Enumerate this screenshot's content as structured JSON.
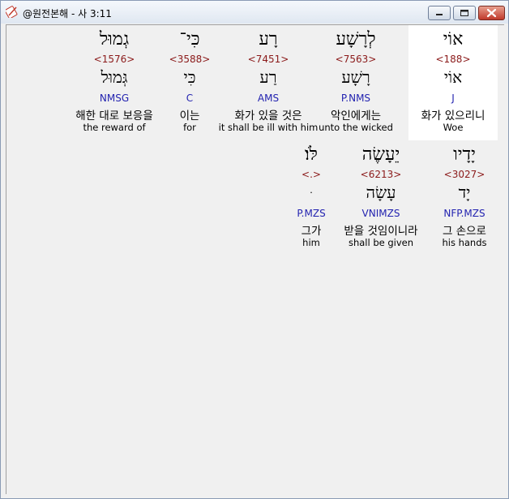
{
  "window": {
    "title": "@원전본해 - 사 3:11"
  },
  "rows": [
    [
      {
        "heb": "אוֹי",
        "strong": "<188>",
        "root": "אוֹי",
        "morph": "J",
        "kor": "화가 있으리니",
        "eng": "Woe",
        "highlighted": true
      },
      {
        "heb": "לְרָשָׁע",
        "strong": "<7563>",
        "root": "רָשָׁע",
        "morph": "P.NMS",
        "kor": "악인에게는",
        "eng": "unto the wicked",
        "highlighted": false
      },
      {
        "heb": "רָע",
        "strong": "<7451>",
        "root": "רַע",
        "morph": "AMS",
        "kor": "화가 있을 것은",
        "eng": "it shall be ill with him",
        "highlighted": false
      },
      {
        "heb": "כִּי־",
        "strong": "<3588>",
        "root": "כִּי",
        "morph": "C",
        "kor": "이는",
        "eng": "for",
        "highlighted": false
      },
      {
        "heb": "גְמוּל",
        "strong": "<1576>",
        "root": "גְּמוּל",
        "morph": "NMSG",
        "kor": "해한 대로 보응을",
        "eng": "the reward of",
        "highlighted": false
      }
    ],
    [
      {
        "heb": "יָדָיו",
        "strong": "<3027>",
        "root": "יָד",
        "morph": "NFP.MZS",
        "kor": "그 손으로",
        "eng": "his hands",
        "highlighted": false
      },
      {
        "heb": "יֵעָשֶׂה",
        "strong": "<6213>",
        "root": "עָשָׂה",
        "morph": "VNIMZS",
        "kor": "받을 것임이니라",
        "eng": "shall be given",
        "highlighted": false
      },
      {
        "heb": "לֹּו׃",
        "strong": "<.>",
        "root": "ּ",
        "morph": "P.MZS",
        "kor": "그가",
        "eng": "him",
        "highlighted": false
      }
    ]
  ]
}
